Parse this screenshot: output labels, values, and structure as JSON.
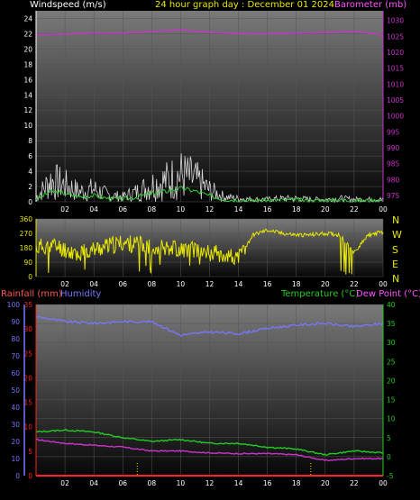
{
  "header": {
    "left_label": "Windspeed (m/s)",
    "title": "24 hour graph day : December 01 2024",
    "right_label": "Barometer (mb)"
  },
  "colors": {
    "background": "#000000",
    "wind": "#d8d8d8",
    "gust_avg": "#33cc33",
    "barometer": "#cc33cc",
    "direction": "#e8e800",
    "humidity": "#7777ff",
    "temperature": "#22cc22",
    "dew_point": "#cc33cc",
    "rainfall": "#ff2222",
    "title": "#e8e800",
    "rain_label": "#ff5555",
    "dew_label": "#ff55ff"
  },
  "direction_letters": [
    "N",
    "W",
    "S",
    "E",
    "N"
  ],
  "bottom_header": {
    "rain_label": "Rainfall (mm)",
    "humidity_label": "Humidity",
    "temp_label": "Temperature (°C)",
    "dew_label": "Dew Point (°C)"
  },
  "chart_data": [
    {
      "type": "line",
      "name": "wind-barometer",
      "x_ticks": [
        "02",
        "04",
        "06",
        "08",
        "10",
        "12",
        "14",
        "16",
        "18",
        "20",
        "22",
        "00"
      ],
      "y_left": {
        "label": "Windspeed (m/s)",
        "ticks": [
          0,
          2,
          4,
          6,
          8,
          10,
          12,
          14,
          16,
          18,
          20,
          22,
          24
        ],
        "ylim": [
          0,
          25
        ]
      },
      "y_right": {
        "label": "Barometer (mb)",
        "ticks": [
          975,
          980,
          985,
          990,
          995,
          1000,
          1005,
          1010,
          1015,
          1020,
          1025,
          1030
        ],
        "ylim": [
          973,
          1033
        ]
      },
      "series": [
        {
          "name": "Windspeed",
          "x": [
            0,
            1,
            2,
            3,
            4,
            5,
            6,
            7,
            8,
            9,
            10,
            11,
            12,
            13,
            14,
            15,
            16,
            17,
            18,
            19,
            20,
            21,
            22,
            23,
            24
          ],
          "values": [
            0.5,
            2.5,
            2.0,
            1.2,
            1.5,
            0.8,
            0.6,
            1.2,
            2.0,
            2.5,
            3.2,
            2.6,
            1.4,
            0.6,
            0.4,
            0.3,
            0.3,
            0.4,
            0.4,
            0.3,
            0.3,
            0.4,
            0.3,
            0.3,
            0.3
          ]
        },
        {
          "name": "Barometer",
          "x": [
            0,
            2,
            4,
            6,
            8,
            10,
            12,
            14,
            16,
            18,
            20,
            22,
            24
          ],
          "values": [
            1025.5,
            1025.7,
            1026.0,
            1026.0,
            1026.5,
            1027.0,
            1026.3,
            1025.8,
            1025.8,
            1026.0,
            1026.2,
            1026.5,
            1025.5
          ]
        }
      ]
    },
    {
      "type": "line",
      "name": "wind-direction",
      "x_ticks": [
        "02",
        "04",
        "06",
        "08",
        "10",
        "12",
        "14",
        "16",
        "18",
        "20",
        "22",
        "00"
      ],
      "y_left": {
        "ticks": [
          0,
          90,
          180,
          270,
          360
        ],
        "ylim": [
          0,
          360
        ]
      },
      "series": [
        {
          "name": "Wind direction",
          "x": [
            0,
            1,
            2,
            3,
            4,
            5,
            6,
            7,
            8,
            9,
            10,
            11,
            12,
            13,
            14,
            15,
            16,
            17,
            18,
            19,
            20,
            21,
            22,
            23,
            24
          ],
          "values": [
            180,
            200,
            170,
            140,
            170,
            190,
            210,
            200,
            180,
            190,
            170,
            170,
            150,
            140,
            110,
            260,
            290,
            270,
            260,
            260,
            270,
            260,
            150,
            260,
            280
          ]
        }
      ]
    },
    {
      "type": "line",
      "name": "temperature-humidity",
      "x_ticks": [
        "02",
        "04",
        "06",
        "08",
        "10",
        "12",
        "14",
        "16",
        "18",
        "20",
        "22",
        "00"
      ],
      "y_left_rain": {
        "label": "Rainfall (mm)",
        "ticks": [
          0,
          5,
          10,
          15,
          20,
          25,
          30,
          35
        ],
        "ylim": [
          0,
          35
        ]
      },
      "y_left_humidity": {
        "label": "Humidity",
        "ticks": [
          0,
          10,
          20,
          30,
          40,
          50,
          60,
          70,
          80,
          90,
          100
        ],
        "ylim": [
          0,
          100
        ]
      },
      "y_right": {
        "label": "Temperature (°C) Dew Point (°C)",
        "ticks": [
          -5,
          0,
          5,
          10,
          15,
          20,
          25,
          30,
          35,
          40
        ],
        "ylim": [
          -5,
          40
        ]
      },
      "series": [
        {
          "name": "Humidity",
          "x": [
            0,
            2,
            4,
            6,
            8,
            10,
            12,
            14,
            16,
            18,
            20,
            22,
            24
          ],
          "values": [
            93,
            90,
            89,
            90,
            90,
            82,
            84,
            83,
            86,
            88,
            89,
            87,
            89
          ]
        },
        {
          "name": "Temperature",
          "x": [
            0,
            2,
            4,
            6,
            8,
            10,
            12,
            14,
            16,
            18,
            20,
            22,
            24
          ],
          "values": [
            6.5,
            7.0,
            6.5,
            5.0,
            4.0,
            4.5,
            3.5,
            3.5,
            2.5,
            2.0,
            0.5,
            1.5,
            1.0
          ]
        },
        {
          "name": "Dew Point",
          "x": [
            0,
            2,
            4,
            6,
            8,
            10,
            12,
            14,
            16,
            18,
            20,
            22,
            24
          ],
          "values": [
            4.5,
            3.5,
            3.0,
            2.5,
            1.5,
            1.5,
            1.0,
            0.8,
            0.8,
            0.5,
            -1.0,
            -0.5,
            -0.5
          ]
        },
        {
          "name": "Rainfall",
          "x": [
            0,
            24
          ],
          "values": [
            0,
            0
          ]
        }
      ]
    }
  ]
}
